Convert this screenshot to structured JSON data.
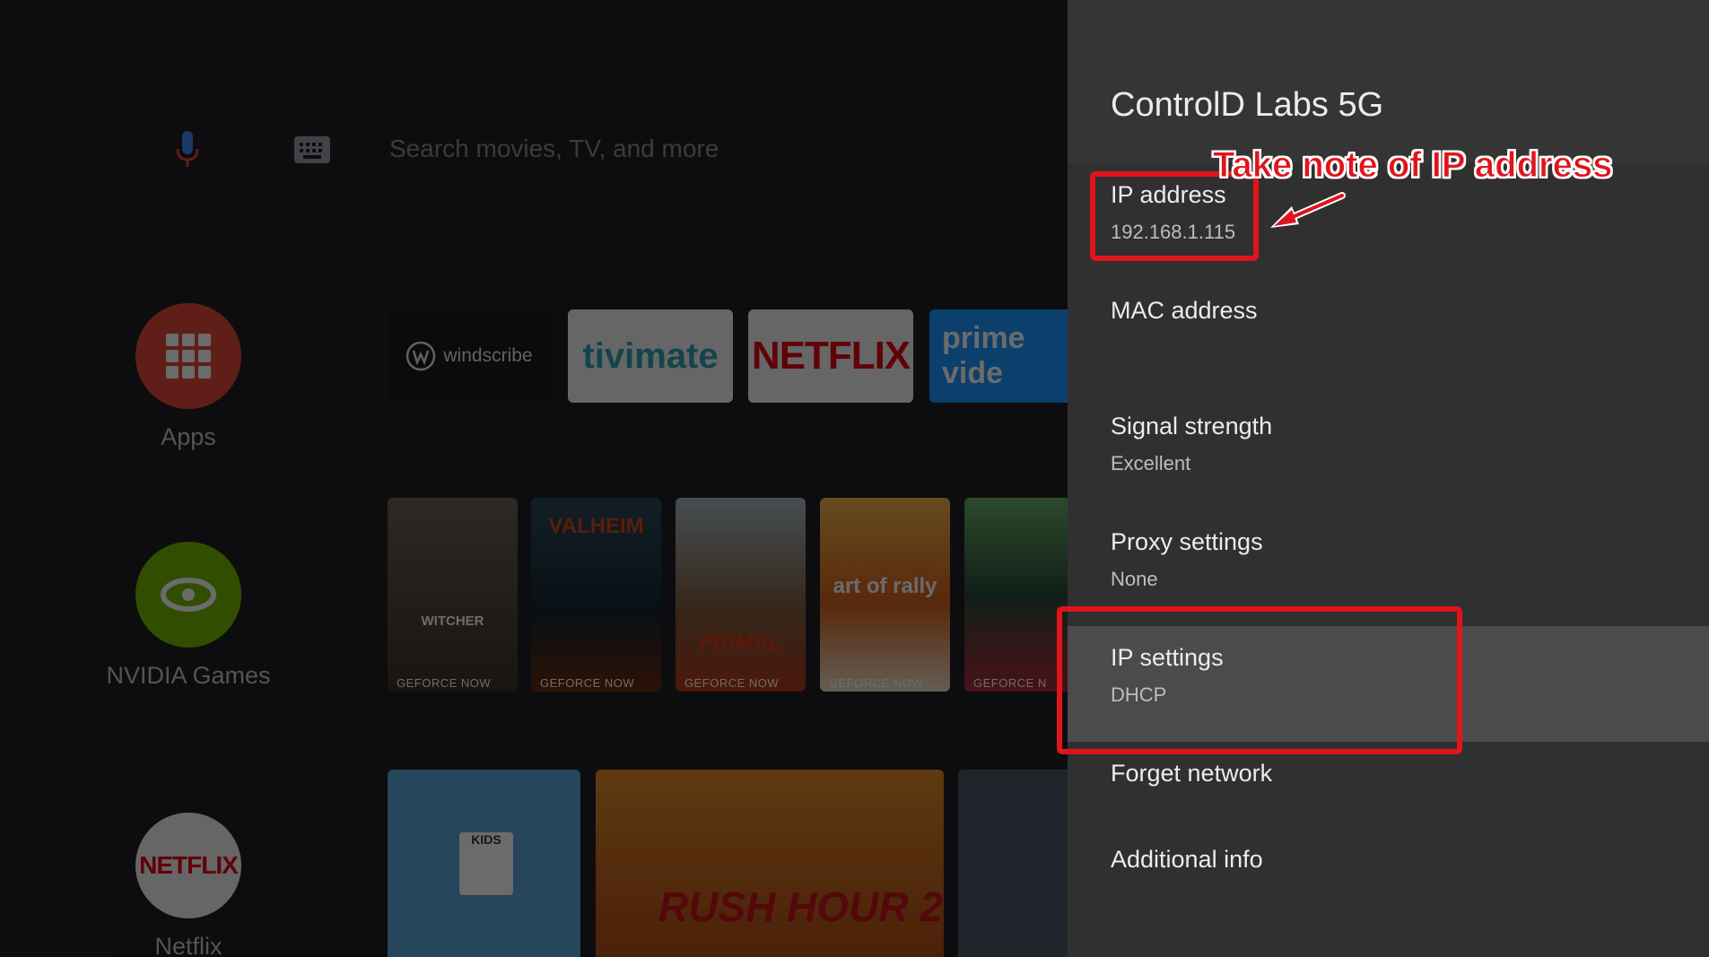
{
  "home": {
    "search_placeholder": "Search movies, TV, and more",
    "nav": [
      {
        "label": "Apps"
      },
      {
        "label": "NVIDIA Games"
      },
      {
        "label": "Netflix"
      }
    ],
    "apps_row": [
      "windscribe",
      "tivimate",
      "NETFLIX",
      "prime vide"
    ],
    "games": [
      {
        "title": "WITCHER",
        "badge": "GEFORCE NOW"
      },
      {
        "title": "VALHEIM",
        "badge": "GEFORCE NOW"
      },
      {
        "title": "PRIMAL",
        "badge": "GEFORCE NOW"
      },
      {
        "title": "art of rally",
        "badge": "GEFORCE NOW"
      },
      {
        "title": "",
        "badge": "GEFORCE N"
      }
    ],
    "bottom_row": [
      {
        "title": "KIDS"
      },
      {
        "title": "RUSH HOUR 2"
      },
      {
        "title": ""
      }
    ],
    "netflix_logo": "NETFLIX"
  },
  "settings": {
    "network_name": "ControlD Labs 5G",
    "items": [
      {
        "title": "IP address",
        "subtitle": "192.168.1.115"
      },
      {
        "title": "MAC address",
        "subtitle": ""
      },
      {
        "title": "Signal strength",
        "subtitle": "Excellent"
      },
      {
        "title": "Proxy settings",
        "subtitle": "None"
      },
      {
        "title": "IP settings",
        "subtitle": "DHCP"
      },
      {
        "title": "Forget network",
        "subtitle": ""
      },
      {
        "title": "Additional info",
        "subtitle": ""
      }
    ]
  },
  "annotation": {
    "note": "Take note of IP address",
    "color": "#e0141b"
  }
}
